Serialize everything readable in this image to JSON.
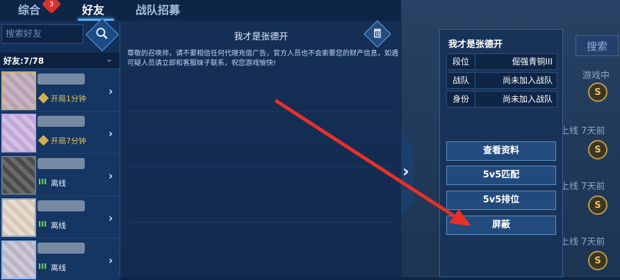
{
  "tabs": [
    {
      "label": "综合",
      "badge": "3"
    },
    {
      "label": "好友"
    },
    {
      "label": "战队招募"
    }
  ],
  "sidebar": {
    "search_placeholder": "搜索好友",
    "friend_count": "好友:7/78",
    "friends": [
      {
        "status": "开局1分钟",
        "status_type": "in-game"
      },
      {
        "status": "开局7分钟",
        "status_type": "in-game"
      },
      {
        "status": "离线",
        "status_type": "offline"
      },
      {
        "status": "离线",
        "status_type": "offline"
      },
      {
        "status": "离线",
        "status_type": "offline"
      }
    ]
  },
  "chat": {
    "title": "我才是张德开",
    "notice": "尊敬的召唤师，请不要相信任何代理充值广告，官方人员也不会索要您的财产信息，如遇可疑人员请立即和客服妹子联系，祝您游戏愉快!"
  },
  "popup": {
    "name": "我才是张德开",
    "info": [
      {
        "label": "段位",
        "value": "倔强青铜III"
      },
      {
        "label": "战队",
        "value": "尚未加入战队"
      },
      {
        "label": "身份",
        "value": "尚未加入战队"
      }
    ],
    "actions": [
      "查看资料",
      "5v5匹配",
      "5v5排位",
      "屏蔽"
    ]
  },
  "background": {
    "search_label": "搜索",
    "rows": [
      {
        "text": "游戏中"
      },
      {
        "text": "最近上线  7天前"
      },
      {
        "text": "最近上线  7天前"
      },
      {
        "text": "最近上线  7天前"
      },
      {
        "text": "最近上线  7天前"
      }
    ]
  },
  "colors": {
    "accent": "#57b4ff",
    "arrow": "#e8302b",
    "in_game": "#e8c45a",
    "offline_icon": "#6fd35c"
  }
}
